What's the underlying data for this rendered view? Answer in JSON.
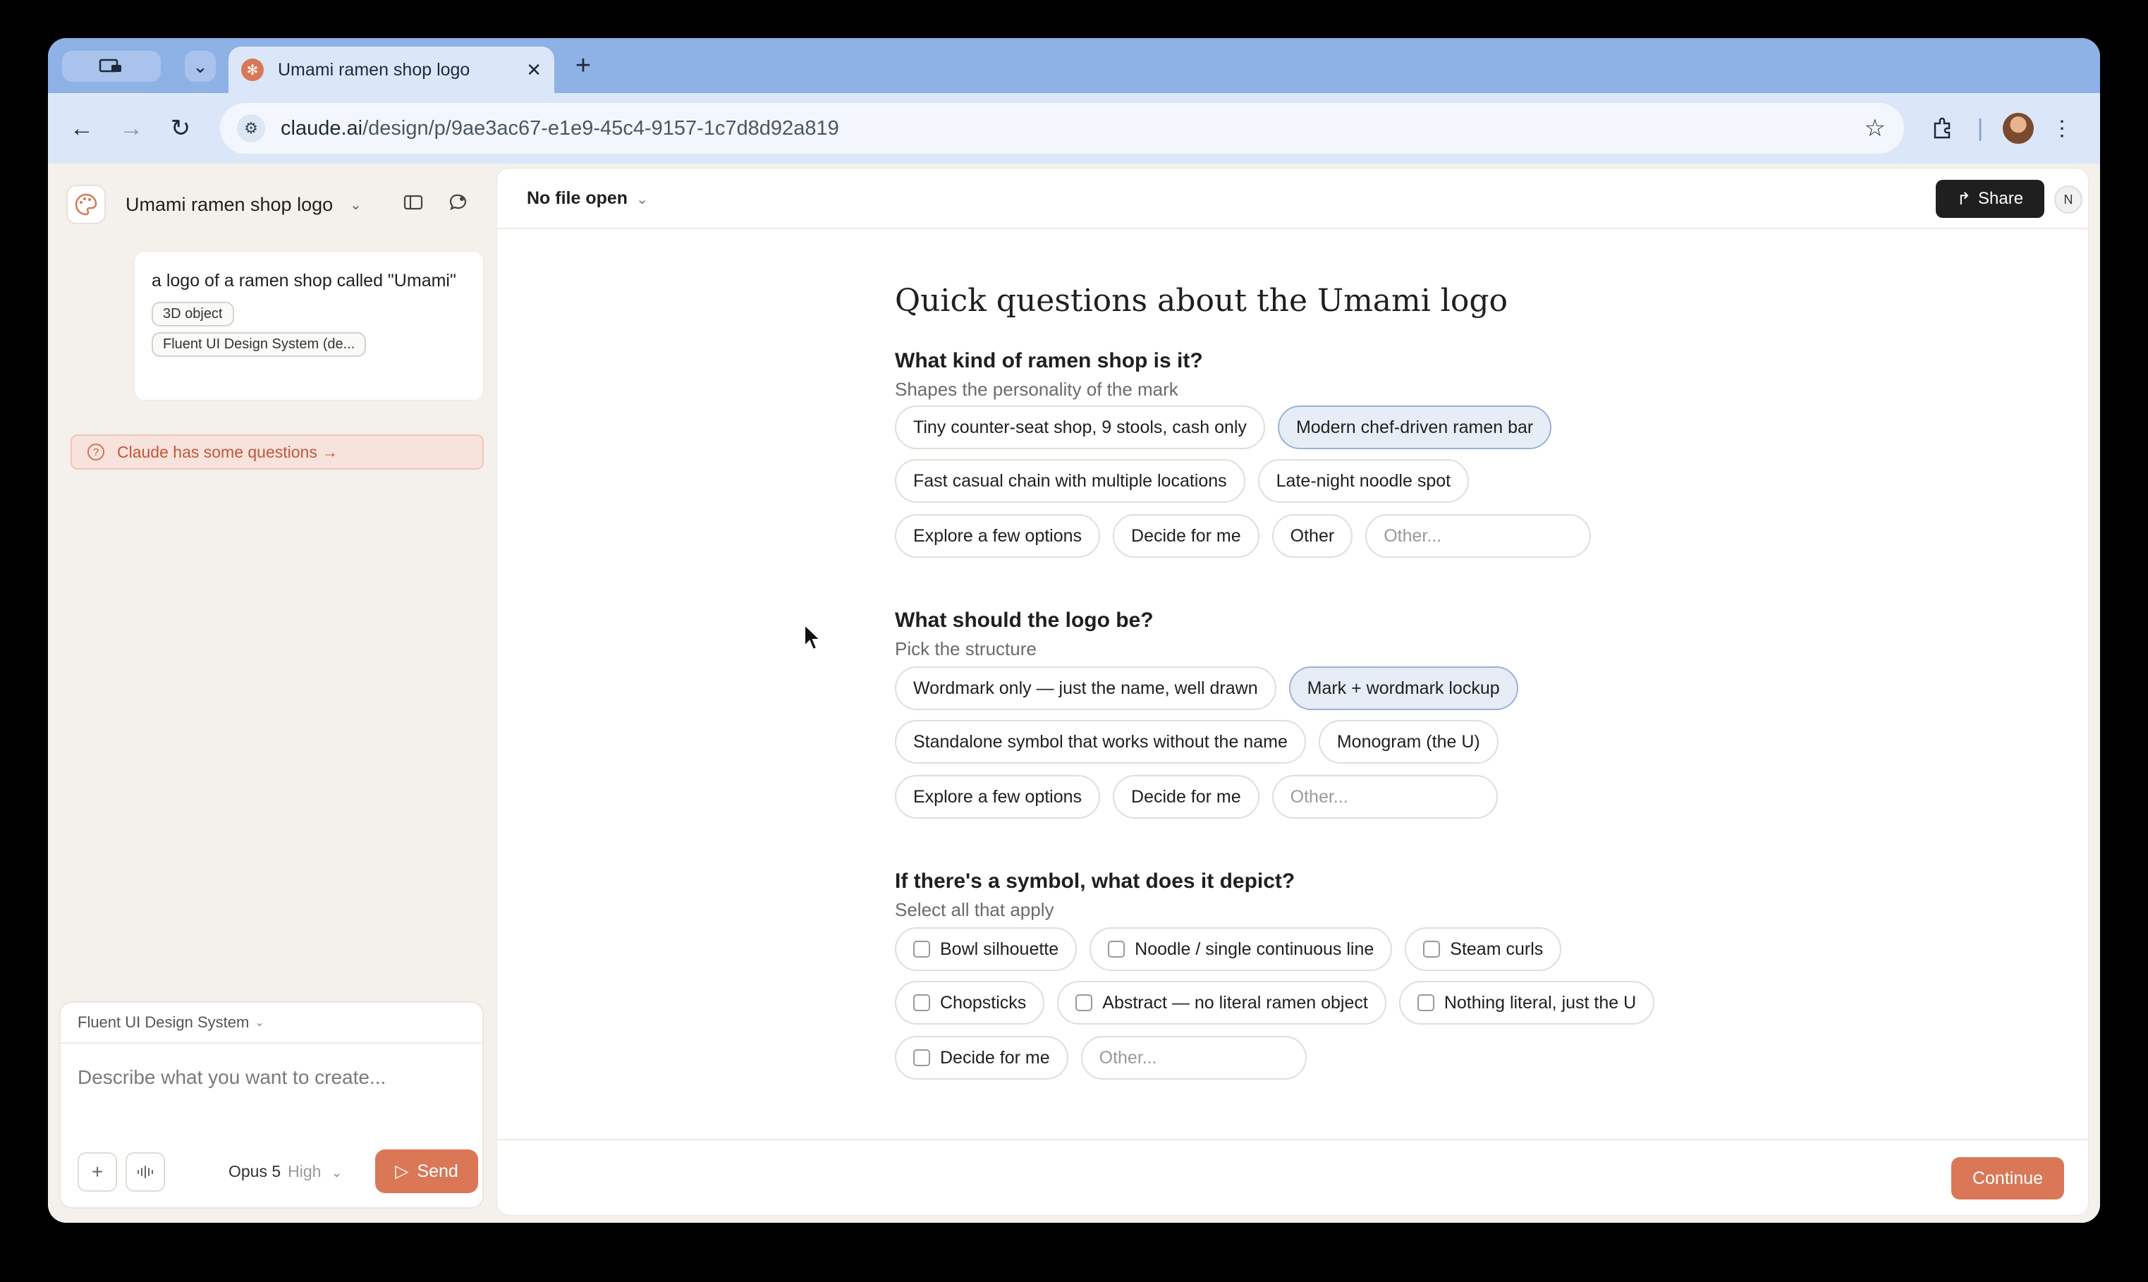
{
  "browser": {
    "tab_title": "Umami ramen shop logo",
    "url_host": "claude.ai",
    "url_path": "/design/p/9ae3ac67-e1e9-45c4-9157-1c7d8d92a819"
  },
  "sidebar": {
    "project_title": "Umami ramen shop logo",
    "message_text": "a logo of a ramen shop called \"Umami\"",
    "tags": [
      "3D object",
      "Fluent UI Design System (de..."
    ],
    "notice": "Claude has some questions →",
    "composer": {
      "design_system": "Fluent UI Design System",
      "placeholder": "Describe what you want to create...",
      "model": "Opus 5",
      "effort": "High",
      "send_label": "Send"
    }
  },
  "main": {
    "file_selector": "No file open",
    "share_label": "Share",
    "avatar_initial": "N",
    "title": "Quick questions about the Umami logo",
    "questions": [
      {
        "label": "What kind of ramen shop is it?",
        "sub": "Shapes the personality of the mark",
        "options": [
          "Tiny counter-seat shop, 9 stools, cash only",
          "Modern chef-driven ramen bar",
          "Fast casual chain with multiple locations",
          "Late-night noodle spot",
          "Explore a few options",
          "Decide for me",
          "Other"
        ],
        "selected": "Modern chef-driven ramen bar",
        "other_placeholder": "Other..."
      },
      {
        "label": "What should the logo be?",
        "sub": "Pick the structure",
        "options": [
          "Wordmark only — just the name, well drawn",
          "Mark + wordmark lockup",
          "Standalone symbol that works without the name",
          "Monogram (the U)",
          "Explore a few options",
          "Decide for me"
        ],
        "selected": "Mark + wordmark lockup",
        "other_placeholder": "Other..."
      },
      {
        "label": "If there's a symbol, what does it depict?",
        "sub": "Select all that apply",
        "options": [
          "Bowl silhouette",
          "Noodle / single continuous line",
          "Steam curls",
          "Chopsticks",
          "Abstract — no literal ramen object",
          "Nothing literal, just the U",
          "Decide for me"
        ],
        "other_placeholder": "Other..."
      }
    ],
    "continue_label": "Continue"
  }
}
